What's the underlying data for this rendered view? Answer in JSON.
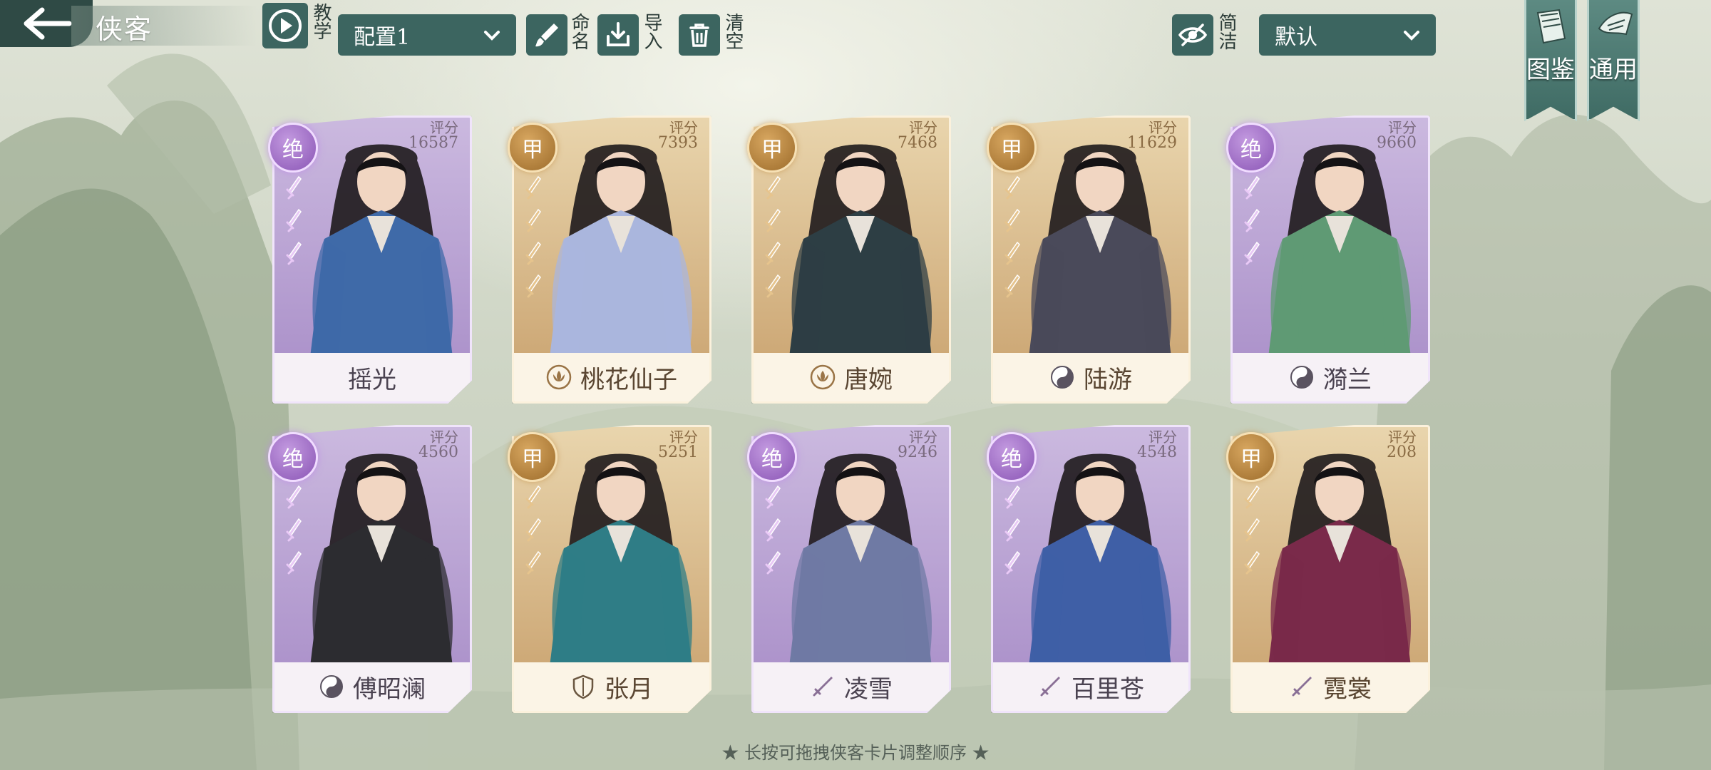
{
  "header": {
    "title": "侠客",
    "tutorial_label": "教学",
    "config_select": "配置1",
    "rename_label": "命名",
    "import_label": "导入",
    "clear_label": "清空",
    "simple_label": "简洁",
    "sort_select": "默认"
  },
  "side_tabs": {
    "codex_label": "图鉴",
    "general_label": "通用"
  },
  "score_label": "评分",
  "cards": [
    {
      "name": "摇光",
      "rank": "绝",
      "score": "16587",
      "faction_icon": "none",
      "stars": 3,
      "tone": "jue",
      "robe": "#3f6aa8"
    },
    {
      "name": "桃花仙子",
      "rank": "甲",
      "score": "7393",
      "faction_icon": "lotus-icon",
      "stars": 4,
      "tone": "jia",
      "robe": "#aab6dd"
    },
    {
      "name": "唐婉",
      "rank": "甲",
      "score": "7468",
      "faction_icon": "lotus-icon",
      "stars": 4,
      "tone": "jia",
      "robe": "#2d3e44"
    },
    {
      "name": "陆游",
      "rank": "甲",
      "score": "11629",
      "faction_icon": "yin-yang-icon",
      "stars": 4,
      "tone": "jia",
      "robe": "#4a4a5a"
    },
    {
      "name": "漪兰",
      "rank": "绝",
      "score": "9660",
      "faction_icon": "yin-yang-icon",
      "stars": 3,
      "tone": "jue",
      "robe": "#5f9a74"
    },
    {
      "name": "傅昭澜",
      "rank": "绝",
      "score": "4560",
      "faction_icon": "yin-yang-icon",
      "stars": 3,
      "tone": "jue",
      "robe": "#2c2c30"
    },
    {
      "name": "张月",
      "rank": "甲",
      "score": "5251",
      "faction_icon": "shield-icon",
      "stars": 3,
      "tone": "jia",
      "robe": "#2f7d86"
    },
    {
      "name": "凌雪",
      "rank": "绝",
      "score": "9246",
      "faction_icon": "sword-icon",
      "stars": 3,
      "tone": "jue",
      "robe": "#6f7aa4"
    },
    {
      "name": "百里苍",
      "rank": "绝",
      "score": "4548",
      "faction_icon": "sword-icon",
      "stars": 3,
      "tone": "jue",
      "robe": "#3f5fa6"
    },
    {
      "name": "霓裳",
      "rank": "甲",
      "score": "208",
      "faction_icon": "sword-icon",
      "stars": 3,
      "tone": "jia",
      "robe": "#7a2a4a"
    }
  ],
  "hint": "★ 长按可拖拽侠客卡片调整顺序 ★"
}
